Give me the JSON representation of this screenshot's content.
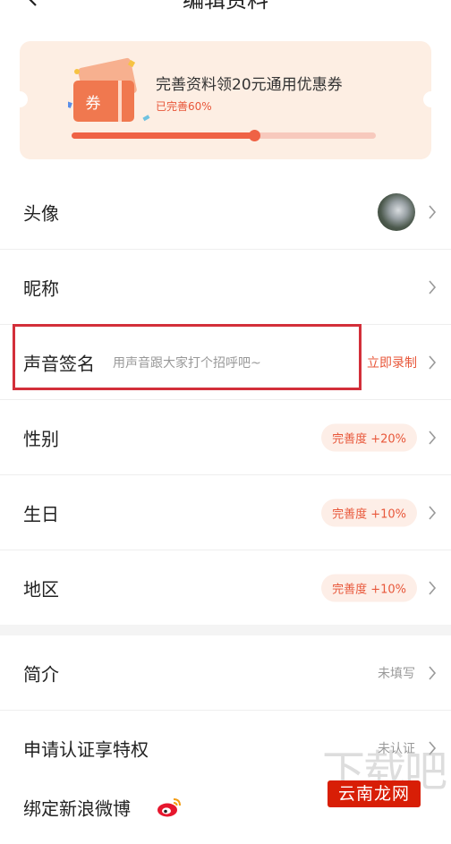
{
  "header": {
    "title": "编辑资料"
  },
  "banner": {
    "title": "完善资料领20元通用优惠券",
    "progress_text": "已完善60%",
    "progress": 0.6,
    "ticket_label": "券"
  },
  "rows": [
    {
      "label": "头像"
    },
    {
      "label": "昵称"
    },
    {
      "label": "声音签名",
      "hint": "用声音跟大家打个招呼吧~",
      "action": "立即录制"
    },
    {
      "label": "性别",
      "badge": "完善度 +20%"
    },
    {
      "label": "生日",
      "badge": "完善度 +10%"
    },
    {
      "label": "地区",
      "badge": "完善度 +10%"
    },
    {
      "label": "简介",
      "value": "未填写"
    },
    {
      "label": "申请认证享特权",
      "value": "未认证"
    },
    {
      "label": "绑定新浪微博"
    }
  ],
  "colors": {
    "accent": "#e8573a",
    "banner_bg": "#fdeee3",
    "highlight": "#d32f3a"
  },
  "watermark": {
    "text": "云南龙网",
    "ghost": "下载吧"
  }
}
